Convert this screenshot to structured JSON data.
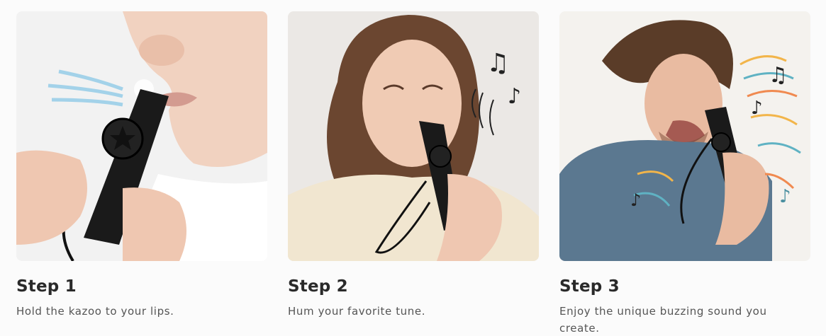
{
  "steps": [
    {
      "title": "Step 1",
      "description": "Hold the kazoo to your lips.",
      "image_icon": "kazoo-lips-photo"
    },
    {
      "title": "Step 2",
      "description": "Hum your favorite tune.",
      "image_icon": "kazoo-hum-photo"
    },
    {
      "title": "Step 3",
      "description": "Enjoy the unique buzzing sound you create.",
      "image_icon": "kazoo-buzz-photo"
    }
  ],
  "colors": {
    "background": "#fbfbfb",
    "title": "#2a2a2a",
    "description": "#555555",
    "kazoo": "#1a1a1a"
  }
}
